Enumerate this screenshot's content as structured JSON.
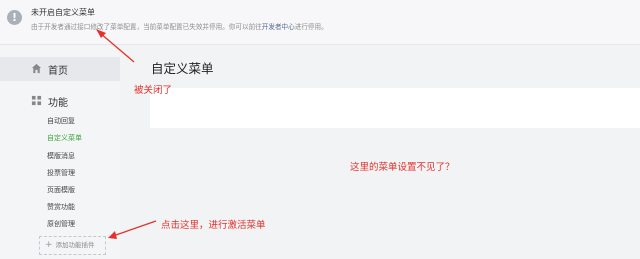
{
  "notice": {
    "icon": "info-icon",
    "title": "未开启自定义菜单",
    "desc_prefix": "由于开发者通过接口修改了菜单配置，当前菜单配置已失效并停用。你可以前往",
    "desc_link": "开发者中心",
    "desc_suffix": "进行停用。"
  },
  "sidebar": {
    "home": {
      "icon": "home-icon",
      "label": "首页"
    },
    "function": {
      "icon": "grid-icon",
      "label": "功能"
    },
    "items": [
      "自动回复",
      "自定义菜单",
      "模版消息",
      "投票管理",
      "页面模版",
      "赞赏功能",
      "原创管理"
    ],
    "active_index": 1,
    "add_plugin": "添加功能插件"
  },
  "main": {
    "title": "自定义菜单"
  },
  "annotations": {
    "closed": "被关闭了",
    "missing": "这里的菜单设置不见了？",
    "click_here": "点击这里，进行激活菜单"
  },
  "colors": {
    "accent_green": "#3ea43e",
    "annotation_red": "#e5312a",
    "link_blue": "#576b95"
  }
}
